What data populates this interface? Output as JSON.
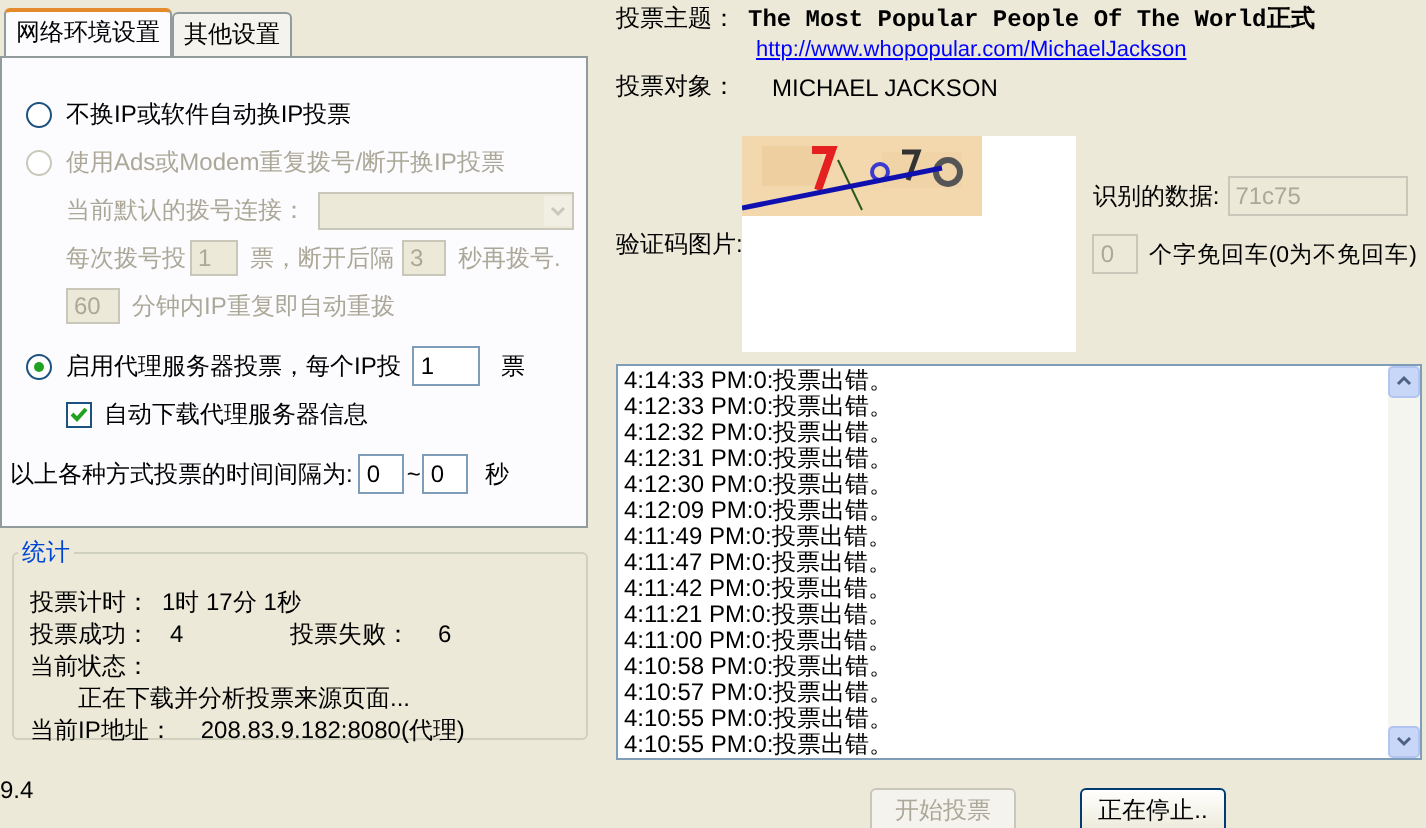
{
  "tabs": [
    {
      "label": "网络环境设置",
      "selected": true
    },
    {
      "label": "其他设置",
      "selected": false
    }
  ],
  "no_change_option": {
    "label": "不换IP或软件自动换IP投票",
    "selected": false
  },
  "dialup": {
    "label": "使用Ads或Modem重复拨号/断开换IP投票",
    "selected": false,
    "disabled": true,
    "connection_label": "当前默认的拨号连接：",
    "per_dial_label": "每次拨号投",
    "per_dial_value": "1",
    "after_label": "票，断开后隔",
    "wait_value": "3",
    "redial_label": "秒再拨号.",
    "minutes_value": "60",
    "minutes_label": "分钟内IP重复即自动重拨"
  },
  "proxy": {
    "label": "启用代理服务器投票，每个IP投",
    "selected": true,
    "votes_value": "1",
    "votes_unit": "票",
    "auto_download": {
      "label": "自动下载代理服务器信息",
      "checked": true
    }
  },
  "interval": {
    "label": "以上各种方式投票的时间间隔为:",
    "min": "0",
    "separator": "~",
    "max": "0",
    "unit": "秒"
  },
  "stats": {
    "title": "统计",
    "timer_label": "投票计时：",
    "timer_value": "1时 17分 1秒",
    "success_label": "投票成功：",
    "success_value": "4",
    "fail_label": "投票失败：",
    "fail_value": "6",
    "status_label": "当前状态：",
    "status_value": "正在下载并分析投票来源页面...",
    "ip_label": "当前IP地址：",
    "ip_value": "208.83.9.182:8080(代理)"
  },
  "version": "9.4",
  "topic": {
    "label": "投票主题：",
    "title": "The Most Popular People Of The World",
    "title_suffix": "正式",
    "url": "http://www.whopopular.com/MichaelJackson"
  },
  "target": {
    "label": "投票对象：",
    "value": "MICHAEL JACKSON"
  },
  "captcha": {
    "label": "验证码图片:",
    "kind": "picture"
  },
  "recognized": {
    "label": "识别的数据:",
    "value": "71c75"
  },
  "enter_chars": {
    "value": "0",
    "label": "个字免回车(0为不免回车)"
  },
  "log": [
    "4:14:33 PM:0:投票出错。",
    "4:12:33 PM:0:投票出错。",
    "4:12:32 PM:0:投票出错。",
    "4:12:31 PM:0:投票出错。",
    "4:12:30 PM:0:投票出错。",
    "4:12:09 PM:0:投票出错。",
    "4:11:49 PM:0:投票出错。",
    "4:11:47 PM:0:投票出错。",
    "4:11:42 PM:0:投票出错。",
    "4:11:21 PM:0:投票出错。",
    "4:11:00 PM:0:投票出错。",
    "4:10:58 PM:0:投票出错。",
    "4:10:57 PM:0:投票出错。",
    "4:10:55 PM:0:投票出错。",
    "4:10:55 PM:0:投票出错。"
  ],
  "buttons": [
    {
      "label": "开始投票",
      "disabled": true
    },
    {
      "label": "正在停止..",
      "disabled": false
    }
  ]
}
